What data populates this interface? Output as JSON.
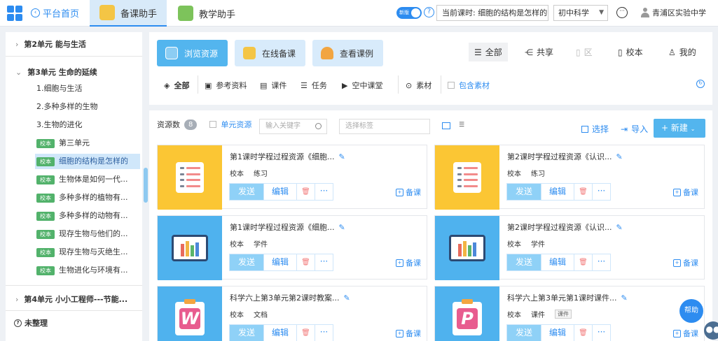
{
  "header": {
    "home_label": "平台首页",
    "tabs": [
      {
        "label": "备课助手",
        "icon": "lesson-prep-icon",
        "active": true
      },
      {
        "label": "教学助手",
        "icon": "teaching-assistant-icon",
        "active": false
      }
    ],
    "toggle_label": "新版",
    "current_lesson": "当前课时: 细胞的结构是怎样的",
    "subject": "初中科学",
    "school": "青浦区实验中学"
  },
  "sidebar": {
    "units_top": [
      {
        "label": "第2单元 能与生活",
        "expanded": false
      },
      {
        "label": "第3单元 生命的延续",
        "expanded": true
      }
    ],
    "plain_items": [
      "1.细胞与生活",
      "2.多种多样的生物",
      "3.生物的进化"
    ],
    "badged_items": [
      {
        "badge": "校本",
        "label": "第三单元",
        "active": false
      },
      {
        "badge": "校本",
        "label": "细胞的结构是怎样的",
        "active": true
      },
      {
        "badge": "校本",
        "label": "生物体是如何一代...",
        "active": false
      },
      {
        "badge": "校本",
        "label": "多种多样的植物有...",
        "active": false
      },
      {
        "badge": "校本",
        "label": "多种多样的动物有...",
        "active": false
      },
      {
        "badge": "校本",
        "label": "现存生物与他们的...",
        "active": false
      },
      {
        "badge": "校本",
        "label": "现存生物与灭绝生...",
        "active": false
      },
      {
        "badge": "校本",
        "label": "生物进化与环境有...",
        "active": false
      }
    ],
    "unit_bottom": "第4单元 小小工程师---节能...",
    "untidy": "未整理"
  },
  "filters": {
    "modes": [
      {
        "label": "浏览资源",
        "icon": "share-icon",
        "active": true
      },
      {
        "label": "在线备课",
        "icon": "lesson-plan-icon",
        "active": false
      },
      {
        "label": "查看课例",
        "icon": "trophy-icon",
        "active": false
      }
    ],
    "scopes": [
      {
        "label": "全部",
        "icon": "list-icon",
        "active": true,
        "disabled": false
      },
      {
        "label": "共享",
        "icon": "share-icon",
        "active": false,
        "disabled": false
      },
      {
        "label": "区",
        "icon": "building-icon",
        "active": false,
        "disabled": true
      },
      {
        "label": "校本",
        "icon": "building-icon",
        "active": false,
        "disabled": false
      },
      {
        "label": "我的",
        "icon": "user-icon",
        "active": false,
        "disabled": false
      }
    ],
    "types": [
      {
        "label": "全部",
        "icon": "layers-icon"
      },
      {
        "label": "参考资料",
        "icon": "word-doc-icon"
      },
      {
        "label": "课件",
        "icon": "slides-icon"
      },
      {
        "label": "任务",
        "icon": "task-list-icon"
      },
      {
        "label": "空中课堂",
        "icon": "video-icon"
      }
    ],
    "material_label": "素材",
    "include_material": "包含素材"
  },
  "toolbar": {
    "count_label": "资源数",
    "count": "8",
    "unit_resource": "单元资源",
    "search_placeholder": "输入关键字",
    "tag_placeholder": "选择标签",
    "select_label": "选择",
    "import_label": "导入",
    "new_label": "+ 新建"
  },
  "cards": [
    {
      "title": "第1课时学程过程资源《细胞...",
      "scope": "校本",
      "type": "练习",
      "thumb": "exercise",
      "type_badge": ""
    },
    {
      "title": "第2课时学程过程资源《认识...",
      "scope": "校本",
      "type": "练习",
      "thumb": "exercise",
      "type_badge": ""
    },
    {
      "title": "第1课时学程过程资源《细胞...",
      "scope": "校本",
      "type": "学件",
      "thumb": "courseware",
      "type_badge": ""
    },
    {
      "title": "第2课时学程过程资源《认识...",
      "scope": "校本",
      "type": "学件",
      "thumb": "courseware",
      "type_badge": ""
    },
    {
      "title": "科学六上第3单元第2课时教案...",
      "scope": "校本",
      "type": "文档",
      "thumb": "word",
      "type_badge": ""
    },
    {
      "title": "科学六上第3单元第1课时课件...",
      "scope": "校本",
      "type": "课件",
      "thumb": "ppt",
      "type_badge": "课件"
    }
  ],
  "card_actions": {
    "send": "发送",
    "edit": "编辑",
    "prep": "备课"
  },
  "help_label": "帮助",
  "colors": {
    "accent": "#2d8cf0",
    "exercise_thumb": "#fbc634",
    "courseware_thumb": "#4fb2ee",
    "word_letter": "#e85c8f",
    "ppt_letter": "#e85c8f",
    "school_badge": "#52b26b"
  }
}
